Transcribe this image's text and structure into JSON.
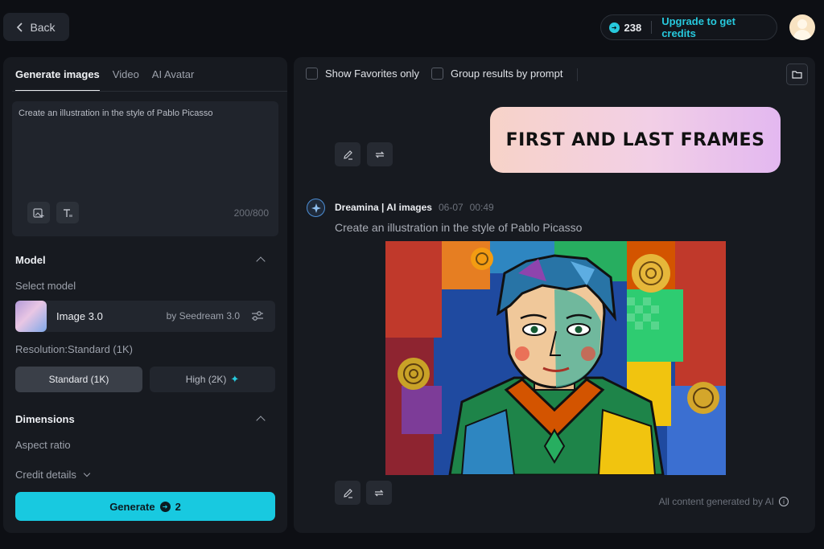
{
  "header": {
    "back_label": "Back",
    "credits_count": "238",
    "upgrade_label": "Upgrade to get credits"
  },
  "left": {
    "tabs": [
      {
        "label": "Generate images",
        "active": true
      },
      {
        "label": "Video",
        "active": false
      },
      {
        "label": "AI Avatar",
        "active": false
      }
    ],
    "prompt_text": "Create an illustration in the style of Pablo Picasso",
    "char_counter": "200/800",
    "model_section": {
      "title": "Model",
      "select_label": "Select model",
      "model_name": "Image 3.0",
      "model_by": "by Seedream 3.0"
    },
    "resolution": {
      "label": "Resolution:Standard (1K)",
      "standard_label": "Standard (1K)",
      "high_label": "High (2K)"
    },
    "dimensions": {
      "title": "Dimensions",
      "aspect_label": "Aspect ratio"
    },
    "credit_details_label": "Credit details",
    "generate_label": "Generate",
    "generate_cost": "2"
  },
  "right": {
    "filters": {
      "favorites_label": "Show Favorites only",
      "group_label": "Group results by prompt"
    },
    "overlay_text": "FIRST AND LAST FRAMES",
    "message": {
      "author": "Dreamina | AI images",
      "date": "06-07",
      "time": "00:49",
      "prompt": "Create an illustration in the style of Pablo Picasso"
    },
    "ai_note": "All content generated by AI"
  },
  "colors": {
    "accent": "#18c9e0",
    "panel": "#171a20",
    "background": "#0d0f14"
  }
}
